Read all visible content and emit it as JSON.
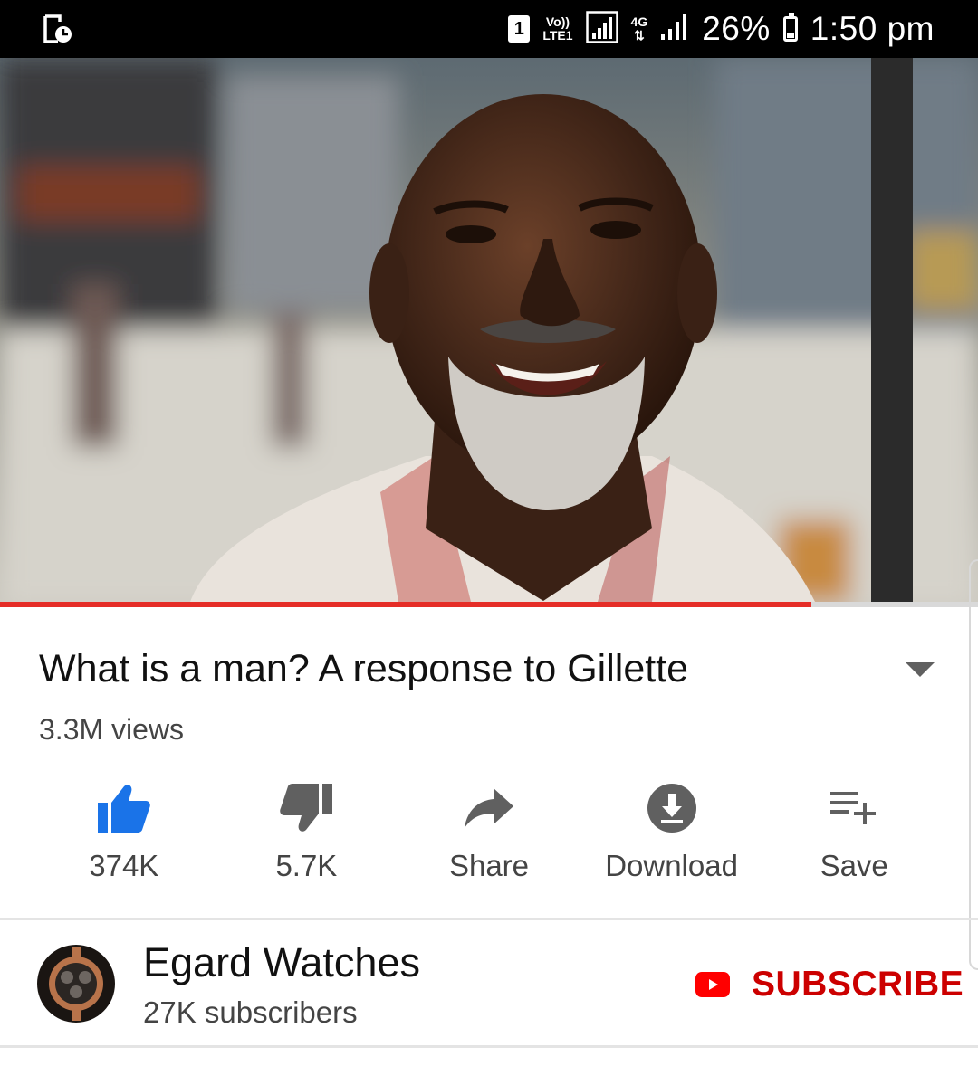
{
  "status_bar": {
    "sim_slot": "1",
    "volte_line1": "Vo))",
    "volte_line2": "LTE1",
    "network_gen": "4G",
    "battery": "26%",
    "time": "1:50 pm",
    "left_icon": "screen-recorder-icon"
  },
  "video": {
    "progress_fraction": 0.83,
    "progress_color": "#e52d27"
  },
  "info": {
    "title": "What is a man? A response to Gillette",
    "views": "3.3M views"
  },
  "actions": [
    {
      "label": "374K",
      "icon": "thumbs-up-icon",
      "active": true
    },
    {
      "label": "5.7K",
      "icon": "thumbs-down-icon",
      "active": false
    },
    {
      "label": "Share",
      "icon": "share-icon",
      "active": false
    },
    {
      "label": "Download",
      "icon": "download-icon",
      "active": false
    },
    {
      "label": "Save",
      "icon": "add-to-playlist-icon",
      "active": false
    }
  ],
  "channel": {
    "name": "Egard Watches",
    "subscribers": "27K subscribers",
    "subscribe_label": "SUBSCRIBE"
  },
  "colors": {
    "accent_blue": "#1a73e8",
    "subscribe_red": "#cc0000",
    "youtube_red": "#ff0000",
    "icon_gray": "#606060"
  }
}
